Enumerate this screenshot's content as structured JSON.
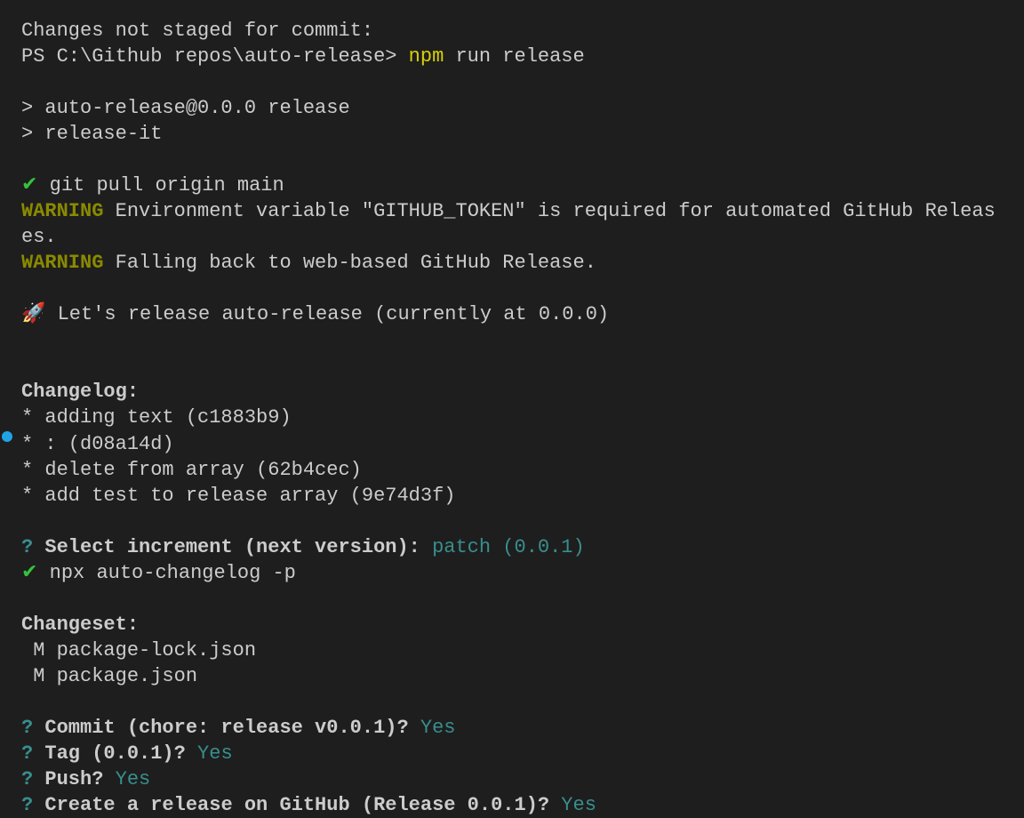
{
  "header": {
    "changes_msg": "Changes not staged for commit:",
    "ps_prompt": "PS C:\\Github repos\\auto-release> ",
    "npm_cmd": "npm",
    "run_release": " run release"
  },
  "script_out": {
    "line1": "> auto-release@0.0.0 release",
    "line2": "> release-it"
  },
  "git_pull": {
    "check": "✔",
    "cmd": " git pull origin main"
  },
  "warn1": {
    "prefix": "WARNING",
    "msg": " Environment variable \"GITHUB_TOKEN\" is required for automated GitHub Releases."
  },
  "warn2": {
    "prefix": "WARNING",
    "msg": " Falling back to web-based GitHub Release."
  },
  "rocket": {
    "icon": "🚀",
    "msg": " Let's release auto-release (currently at 0.0.0)"
  },
  "changelog": {
    "header": "Changelog:",
    "items": [
      "* adding text (c1883b9)",
      "* : (d08a14d)",
      "* delete from array (62b4cec)",
      "* add test to release array (9e74d3f)"
    ]
  },
  "select_inc": {
    "qmark": "?",
    "prompt": " Select increment (next version):",
    "answer": " patch (0.0.1)"
  },
  "npx": {
    "check": "✔",
    "cmd": " npx auto-changelog -p"
  },
  "changeset": {
    "header": "Changeset:",
    "items": [
      " M package-lock.json",
      " M package.json"
    ]
  },
  "prompts": {
    "commit": {
      "q": "?",
      "label": " Commit (chore: release v0.0.1)?",
      "ans": " Yes"
    },
    "tag": {
      "q": "?",
      "label": " Tag (0.0.1)?",
      "ans": " Yes"
    },
    "push": {
      "q": "?",
      "label": " Push?",
      "ans": " Yes"
    },
    "gh": {
      "q": "?",
      "label": " Create a release on GitHub (Release 0.0.1)?",
      "ans": " Yes"
    }
  }
}
